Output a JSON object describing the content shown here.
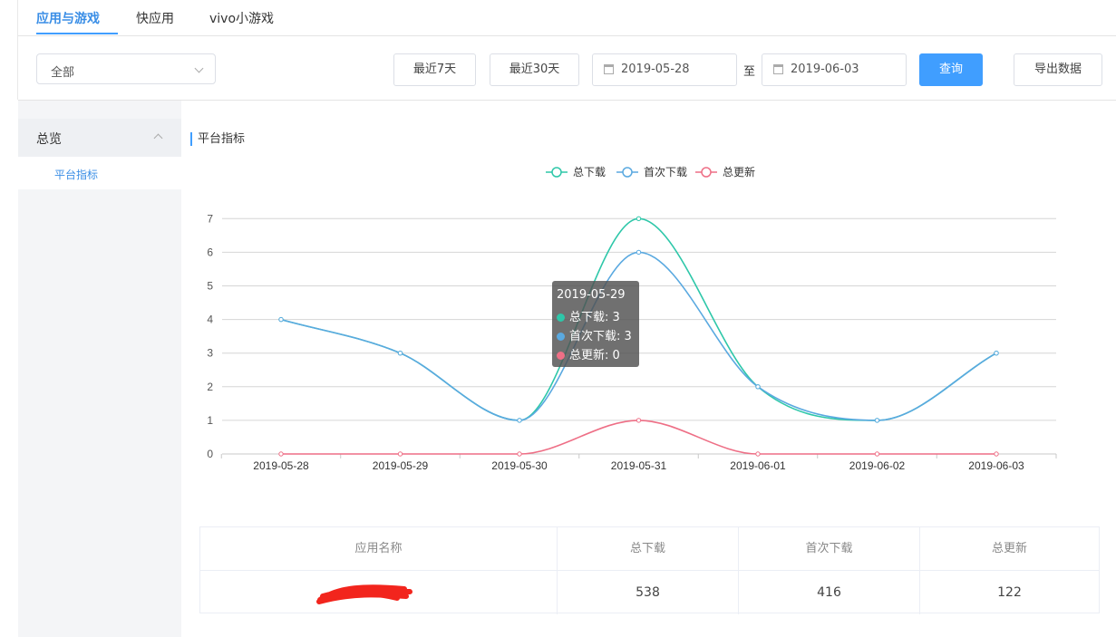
{
  "tabs": [
    {
      "label": "应用与游戏",
      "active": true
    },
    {
      "label": "快应用",
      "active": false
    },
    {
      "label": "vivo小游戏",
      "active": false
    }
  ],
  "toolbar": {
    "select_value": "全部",
    "btn_7days": "最近7天",
    "btn_30days": "最近30天",
    "date_start": "2019-05-28",
    "date_sep": "至",
    "date_end": "2019-06-03",
    "query": "查询",
    "export": "导出数据"
  },
  "sidebar": {
    "group": "总览",
    "item": "平台指标"
  },
  "section_title": "平台指标",
  "colors": {
    "total": "#2ec7a9",
    "first": "#5aa9e0",
    "update": "#ee6f86",
    "accent": "#409eff"
  },
  "chart_data": {
    "type": "line",
    "categories": [
      "2019-05-28",
      "2019-05-29",
      "2019-05-30",
      "2019-05-31",
      "2019-06-01",
      "2019-06-02",
      "2019-06-03"
    ],
    "series": [
      {
        "name": "总下载",
        "values": [
          4,
          3,
          1,
          7,
          2,
          1,
          3
        ]
      },
      {
        "name": "首次下载",
        "values": [
          4,
          3,
          1,
          6,
          2,
          1,
          3
        ]
      },
      {
        "name": "总更新",
        "values": [
          0,
          0,
          0,
          1,
          0,
          0,
          0
        ]
      }
    ],
    "ylim": [
      0,
      7
    ],
    "yticks": [
      0,
      1,
      2,
      3,
      4,
      5,
      6,
      7
    ],
    "grid": true,
    "legend": "top-center",
    "smooth": true
  },
  "tooltip": {
    "date": "2019-05-29",
    "rows": [
      {
        "text": "总下载: 3"
      },
      {
        "text": "首次下载: 3"
      },
      {
        "text": "总更新: 0"
      }
    ]
  },
  "table": {
    "headers": [
      "应用名称",
      "总下载",
      "首次下载",
      "总更新"
    ],
    "row": [
      "",
      "538",
      "416",
      "122"
    ]
  }
}
